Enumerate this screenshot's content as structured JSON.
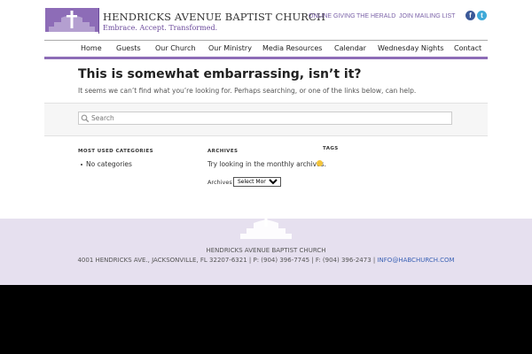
{
  "header": {
    "church_name": "HENDRICKS AVENUE BAPTIST CHURCH",
    "tagline": "Embrace. Accept. Transformed.",
    "top_links": [
      "ONLINE GIVING",
      "THE HERALD",
      "JOIN MAILING LIST"
    ],
    "social": {
      "facebook": "f",
      "twitter": "t"
    },
    "accent_color": "#6b4a9b"
  },
  "nav": {
    "items": [
      "Home",
      "Guests",
      "Our Church",
      "Our Ministry",
      "Media Resources",
      "Calendar",
      "Wednesday Nights",
      "Contact"
    ]
  },
  "main": {
    "title": "This is somewhat embarrassing, isn’t it?",
    "intro": "It seems we can’t find what you’re looking for. Perhaps searching, or one of the links below, can help.",
    "search_placeholder": "Search"
  },
  "widgets": {
    "categories": {
      "title": "MOST USED CATEGORIES",
      "item": "No categories"
    },
    "archives": {
      "title": "ARCHIVES",
      "text": "Try looking in the monthly archives.",
      "label": "Archives",
      "selected": "Select Month"
    },
    "tags": {
      "title": "TAGS"
    }
  },
  "footer": {
    "name": "HENDRICKS AVENUE BAPTIST CHURCH",
    "address": "4001 HENDRICKS AVE., JACKSONVILLE, FL 32207-6321 | P: (904) 396-7745 | F: (904) 396-2473 |",
    "email": "INFO@HABCHURCH.COM"
  }
}
